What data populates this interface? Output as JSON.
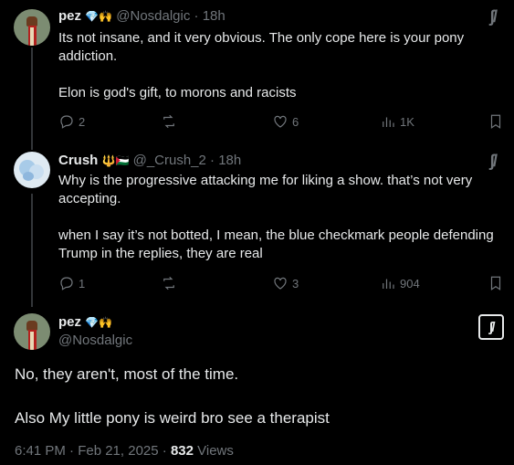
{
  "reply1": {
    "name": "pez",
    "handle": "@Nosdalgic",
    "time": "· 18h",
    "badges": [
      "💎",
      "🙌"
    ],
    "text": "Its not insane, and it very obvious. The only cope here is your pony addiction.\n\nElon is god's gift, to morons and racists",
    "replies": "2",
    "reposts": "",
    "likes": "6",
    "views": "1K",
    "grok_label": "ʃ/"
  },
  "reply2": {
    "name": "Crush",
    "handle": "@_Crush_2",
    "time": "· 18h",
    "badges": [
      "🔱",
      "🇵🇸"
    ],
    "text": "Why is the progressive attacking me for liking a show. that’s not very accepting.\n\nwhen I say it’s not botted, I mean, the blue checkmark people defending Trump in the replies, they are real",
    "replies": "1",
    "reposts": "",
    "likes": "3",
    "views": "904",
    "grok_label": "ʃ/"
  },
  "main": {
    "name": "pez",
    "handle": "@Nosdalgic",
    "badges": [
      "💎",
      "🙌"
    ],
    "line1": "No, they aren't, most of the time.",
    "line2": "Also My little pony is weird bro see a therapist",
    "timestamp": "6:41 PM · Feb 21, 2025 · ",
    "views_count": "832",
    "views_label": " Views",
    "grok_label": "ʃ/"
  }
}
